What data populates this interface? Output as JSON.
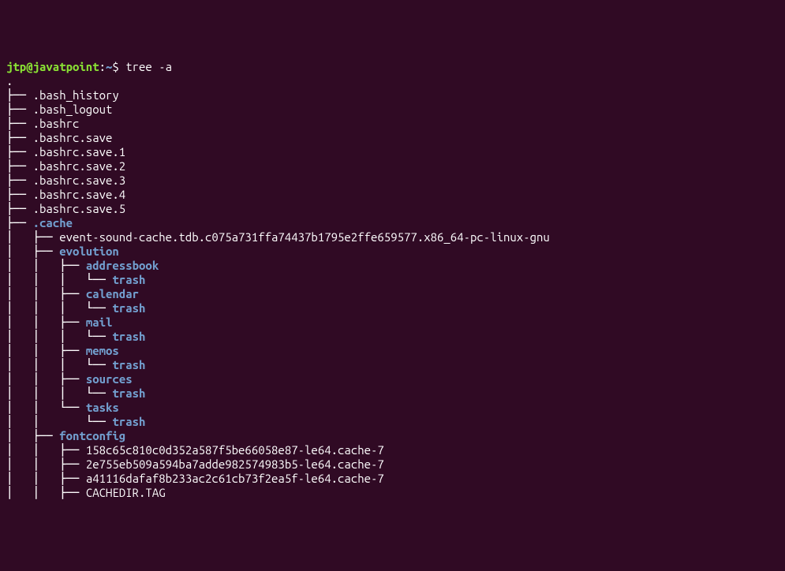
{
  "prompt": {
    "user_host": "jtp@javatpoint",
    "colon": ":",
    "path": "~",
    "dollar": "$ ",
    "command": "tree -a"
  },
  "root_dot": ".",
  "lines": [
    {
      "prefix": "├── ",
      "name": ".bash_history",
      "type": "file"
    },
    {
      "prefix": "├── ",
      "name": ".bash_logout",
      "type": "file"
    },
    {
      "prefix": "├── ",
      "name": ".bashrc",
      "type": "file"
    },
    {
      "prefix": "├── ",
      "name": ".bashrc.save",
      "type": "file"
    },
    {
      "prefix": "├── ",
      "name": ".bashrc.save.1",
      "type": "file"
    },
    {
      "prefix": "├── ",
      "name": ".bashrc.save.2",
      "type": "file"
    },
    {
      "prefix": "├── ",
      "name": ".bashrc.save.3",
      "type": "file"
    },
    {
      "prefix": "├── ",
      "name": ".bashrc.save.4",
      "type": "file"
    },
    {
      "prefix": "├── ",
      "name": ".bashrc.save.5",
      "type": "file"
    },
    {
      "prefix": "├── ",
      "name": ".cache",
      "type": "dir"
    },
    {
      "prefix": "│   ├── ",
      "name": "event-sound-cache.tdb.c075a731ffa74437b1795e2ffe659577.x86_64-pc-linux-gnu",
      "type": "file"
    },
    {
      "prefix": "│   ├── ",
      "name": "evolution",
      "type": "dir"
    },
    {
      "prefix": "│   │   ├── ",
      "name": "addressbook",
      "type": "dir"
    },
    {
      "prefix": "│   │   │   └── ",
      "name": "trash",
      "type": "dir"
    },
    {
      "prefix": "│   │   ├── ",
      "name": "calendar",
      "type": "dir"
    },
    {
      "prefix": "│   │   │   └── ",
      "name": "trash",
      "type": "dir"
    },
    {
      "prefix": "│   │   ├── ",
      "name": "mail",
      "type": "dir"
    },
    {
      "prefix": "│   │   │   └── ",
      "name": "trash",
      "type": "dir"
    },
    {
      "prefix": "│   │   ├── ",
      "name": "memos",
      "type": "dir"
    },
    {
      "prefix": "│   │   │   └── ",
      "name": "trash",
      "type": "dir"
    },
    {
      "prefix": "│   │   ├── ",
      "name": "sources",
      "type": "dir"
    },
    {
      "prefix": "│   │   │   └── ",
      "name": "trash",
      "type": "dir"
    },
    {
      "prefix": "│   │   └── ",
      "name": "tasks",
      "type": "dir"
    },
    {
      "prefix": "│   │       └── ",
      "name": "trash",
      "type": "dir"
    },
    {
      "prefix": "│   ├── ",
      "name": "fontconfig",
      "type": "dir"
    },
    {
      "prefix": "│   │   ├── ",
      "name": "158c65c810c0d352a587f5be66058e87-le64.cache-7",
      "type": "file"
    },
    {
      "prefix": "│   │   ├── ",
      "name": "2e755eb509a594ba7adde982574983b5-le64.cache-7",
      "type": "file"
    },
    {
      "prefix": "│   │   ├── ",
      "name": "a41116dafaf8b233ac2c61cb73f2ea5f-le64.cache-7",
      "type": "file"
    },
    {
      "prefix": "│   │   ├── ",
      "name": "CACHEDIR.TAG",
      "type": "file"
    }
  ]
}
